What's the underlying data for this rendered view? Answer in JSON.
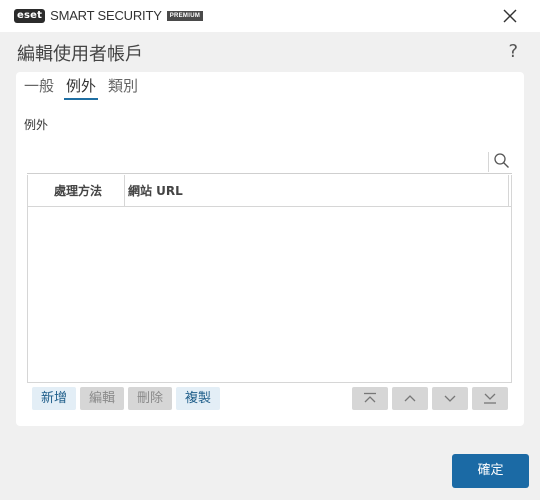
{
  "app": {
    "logo_text": "eset",
    "product_name": "SMART SECURITY",
    "edition": "PREMIUM"
  },
  "dialog": {
    "title": "編輯使用者帳戶",
    "help_label": "?"
  },
  "tabs": [
    {
      "label": "一般",
      "active": false
    },
    {
      "label": "例外",
      "active": true
    },
    {
      "label": "類別",
      "active": false
    }
  ],
  "section": {
    "label": "例外"
  },
  "table": {
    "columns": [
      "處理方法",
      "網站 URL"
    ],
    "rows": []
  },
  "actions": {
    "add": "新增",
    "edit": "編輯",
    "delete": "刪除",
    "copy": "複製"
  },
  "icons": {
    "close": "close-icon",
    "search": "search-icon",
    "move_top": "move-top-icon",
    "move_up": "chevron-up-icon",
    "move_down": "chevron-down-icon",
    "move_bottom": "move-bottom-icon"
  },
  "footer": {
    "ok_label": "確定"
  },
  "colors": {
    "accent": "#1b6aa5",
    "tab_underline": "#1f6fa3",
    "enabled_button_bg": "#e3eef6",
    "disabled_button_bg": "#d6d6d6",
    "window_bg": "#f0f0f0"
  }
}
